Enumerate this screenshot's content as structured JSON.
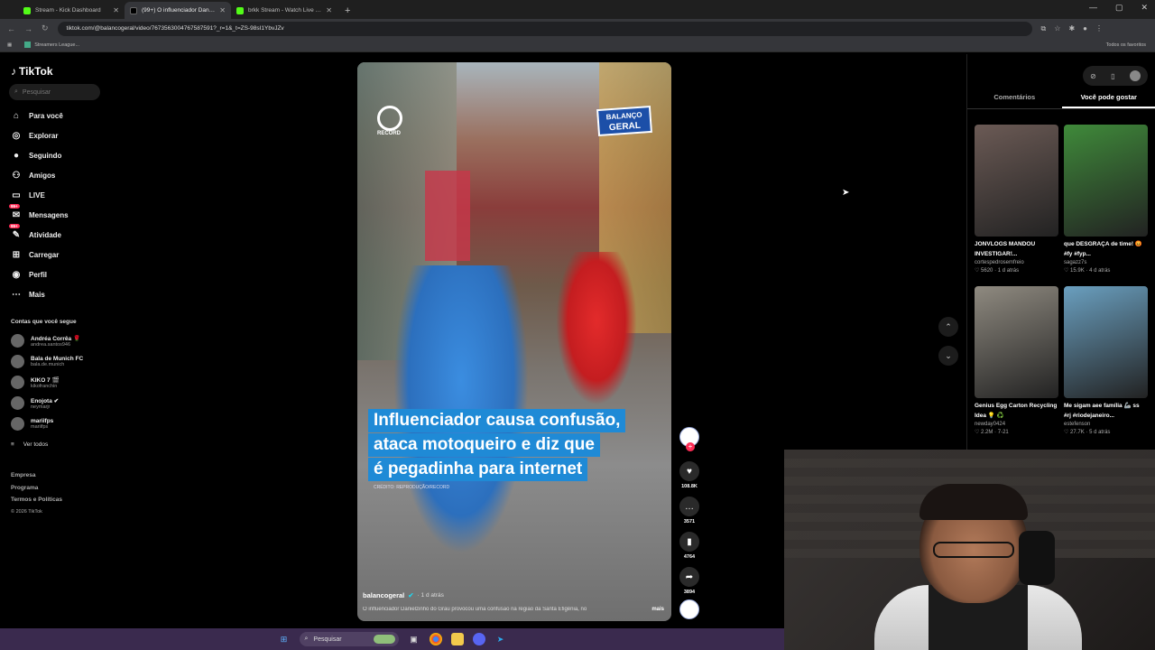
{
  "browser": {
    "tabs": [
      {
        "title": "Stream - Kick Dashboard",
        "favicon_color": "#53fc18"
      },
      {
        "title": "(99+) O influenciador Daniel...",
        "favicon_color": "#000000"
      },
      {
        "title": "brkk Stream - Watch Live on Ki...",
        "favicon_color": "#53fc18"
      }
    ],
    "new_tab": "+",
    "url": "tiktok.com/@balancogeral/video/7673563004767587591?_r=1&_t=ZS-98sI1YbvJZv",
    "bookmark": "Streamers League...",
    "favorites": "Todos os favoritos"
  },
  "tiktok": {
    "logo": "TikTok",
    "search_placeholder": "Pesquisar",
    "nav": [
      {
        "label": "Para você",
        "icon": "home-icon",
        "glyph": "⌂"
      },
      {
        "label": "Explorar",
        "icon": "compass-icon",
        "glyph": "◎"
      },
      {
        "label": "Seguindo",
        "icon": "following-icon",
        "glyph": "●"
      },
      {
        "label": "Amigos",
        "icon": "friends-icon",
        "glyph": "⚇"
      },
      {
        "label": "LIVE",
        "icon": "live-icon",
        "glyph": "▭"
      },
      {
        "label": "Mensagens",
        "icon": "messages-icon",
        "glyph": "✉",
        "badge": "99+"
      },
      {
        "label": "Atividade",
        "icon": "activity-icon",
        "glyph": "✎",
        "badge": "99+"
      },
      {
        "label": "Carregar",
        "icon": "upload-icon",
        "glyph": "⊞"
      },
      {
        "label": "Perfil",
        "icon": "profile-icon",
        "glyph": "◉"
      },
      {
        "label": "Mais",
        "icon": "more-icon",
        "glyph": "⋯"
      }
    ],
    "following_title": "Contas que você segue",
    "following": [
      {
        "name": "Andréa Corrêa 🌹",
        "handle": "andrea.santos946"
      },
      {
        "name": "Bala de Munich FC",
        "handle": "bala.de.munich"
      },
      {
        "name": "KIKO 7 🎬",
        "handle": "kikofranchin"
      },
      {
        "name": "Enojota ✔",
        "handle": "neymarjr"
      },
      {
        "name": "mariifps",
        "handle": "mariifps"
      }
    ],
    "see_all": "Ver todos",
    "footer": [
      "Empresa",
      "Programa",
      "Termos e Políticas"
    ],
    "copyright": "© 2026 TikTok"
  },
  "video": {
    "watermark_left": "RECORD",
    "watermark_right_top": "BALANÇO",
    "watermark_right_bottom": "GERAL",
    "caption_lines": [
      "Influenciador causa confusão,",
      "ataca motoqueiro e diz que",
      "é pegadinha para internet"
    ],
    "credit": "CRÉDITO: REPRODUÇÃO/RECORD",
    "author": "balancogeral",
    "posted": "· 1 d atrás",
    "description": "O influenciador Danielzinho do Grau provocou uma confusão na região da Santa Efigênia, no",
    "more": "mais",
    "likes": "108.8K",
    "comments": "3571",
    "saves": "4764",
    "shares": "3894"
  },
  "right_panel": {
    "tabs": [
      "Comentários",
      "Você pode gostar"
    ],
    "active_tab": 1,
    "cards": [
      {
        "title": "JONVLOGS MANDOU INVESTIGAR!...",
        "author": "cortespedrosemfreio",
        "likes": "♡ 5620",
        "ago": "1 d atrás",
        "color": "#6b5a55"
      },
      {
        "title": "que DESGRAÇA de time! 😡 #fy #fyp...",
        "author": "sagazz7s",
        "likes": "♡ 15.9K",
        "ago": "4 d atrás",
        "color": "#3f8a3a"
      },
      {
        "title": "Genius Egg Carton Recycling Idea 💡 ♻️",
        "author": "newday0424",
        "likes": "♡ 2.2M",
        "ago": "7-21",
        "color": "#8f8a80"
      },
      {
        "title": "Me sigam aee família 🦾 ss #rj #riodejaneiro...",
        "author": "estefenson",
        "likes": "♡ 27.7K",
        "ago": "5 d atrás",
        "color": "#6a9fbf"
      }
    ]
  },
  "taskbar": {
    "search": "Pesquisar"
  },
  "colors": {
    "accent": "#fe2c55",
    "caption_bg": "#1f8ad6",
    "taskbar": "#3a2a4e"
  }
}
